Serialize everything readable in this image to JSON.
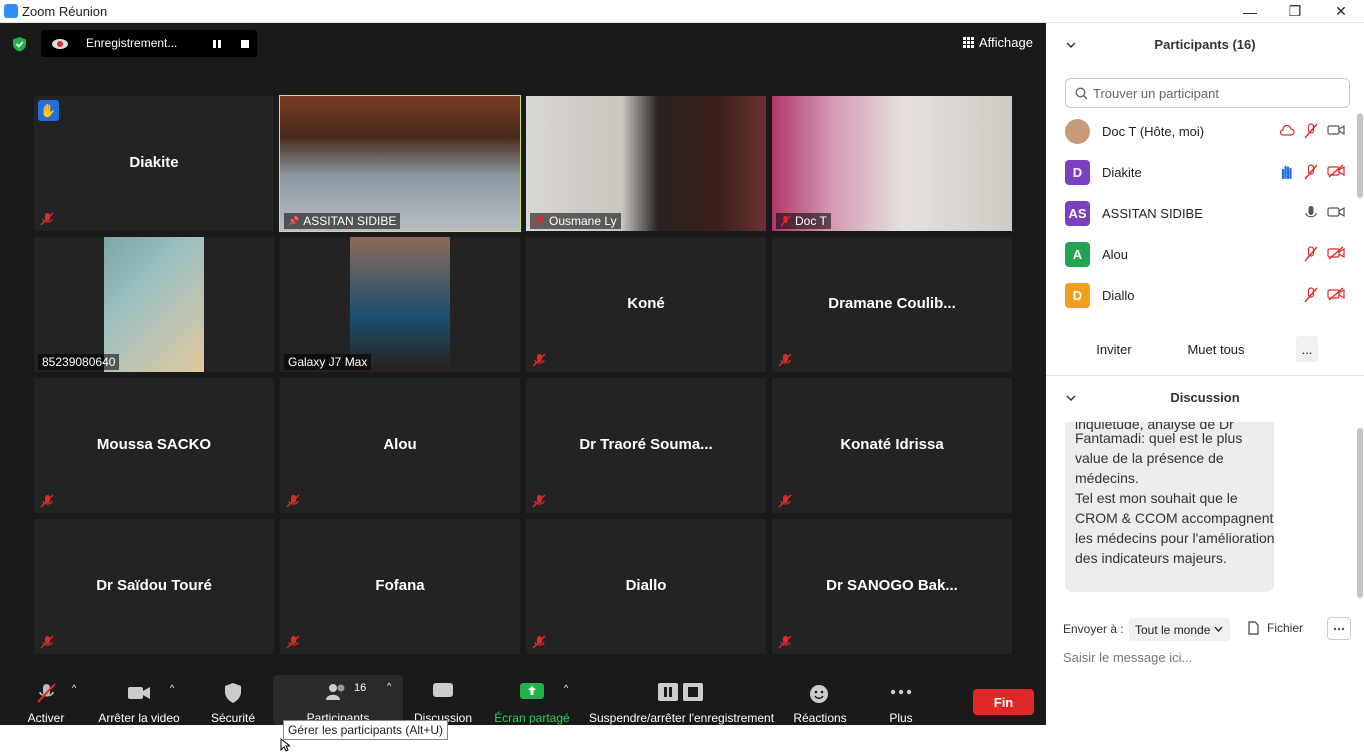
{
  "window": {
    "title": "Zoom Réunion"
  },
  "top": {
    "recording_label": "Enregistrement...",
    "view_label": "Affichage"
  },
  "colors": {
    "active_speaker": "#c9e65a",
    "brand": "#2d8cff",
    "end": "#e02828",
    "green_share": "#24b24b"
  },
  "tiles": [
    {
      "name": "Diakite",
      "hand": true,
      "muted": true,
      "video": false
    },
    {
      "name": "ASSITAN SIDIBE",
      "video": true,
      "muted": false,
      "pinned": true
    },
    {
      "name": "Ousmane Ly",
      "video": true,
      "muted": true
    },
    {
      "name": "Doc T",
      "video": true,
      "muted": true
    },
    {
      "name": "85239080640",
      "video": true,
      "muted": false
    },
    {
      "name": "Galaxy J7 Max",
      "video": true,
      "muted": false
    },
    {
      "name": "Koné",
      "video": false,
      "muted": true
    },
    {
      "name": "Dramane  Coulib...",
      "video": false,
      "muted": true
    },
    {
      "name": "Moussa SACKO",
      "video": false,
      "muted": true
    },
    {
      "name": "Alou",
      "video": false,
      "muted": true
    },
    {
      "name": "Dr  Traoré  Souma...",
      "video": false,
      "muted": true
    },
    {
      "name": "Konaté Idrissa",
      "video": false,
      "muted": true
    },
    {
      "name": "Dr Saïdou Touré",
      "video": false,
      "muted": true
    },
    {
      "name": "Fofana",
      "video": false,
      "muted": true
    },
    {
      "name": "Diallo",
      "video": false,
      "muted": true
    },
    {
      "name": "Dr SANOGO Bak...",
      "video": false,
      "muted": true
    }
  ],
  "toolbar": {
    "unmute": "Activer",
    "video": "Arrêter la video",
    "security": "Sécurité",
    "participants": "Participants",
    "participants_count": "16",
    "chat": "Discussion",
    "share": "Écran partagé",
    "record": "Suspendre/arrêter l'enregistrement",
    "reactions": "Réactions",
    "more": "Plus",
    "end": "Fin",
    "tooltip": "Gérer les participants (Alt+U)"
  },
  "panel": {
    "participants_title": "Participants (16)",
    "search_placeholder": "Trouver un participant",
    "participants": [
      {
        "initials": "",
        "name": "Doc T (Hôte, moi)",
        "color": "#6b6b6b"
      },
      {
        "initials": "D",
        "name": "Diakite",
        "color": "#7b3fbf"
      },
      {
        "initials": "AS",
        "name": "ASSITAN SIDIBE",
        "color": "#7b3fbf"
      },
      {
        "initials": "A",
        "name": "Alou",
        "color": "#23a455"
      },
      {
        "initials": "D",
        "name": "Diallo",
        "color": "#f0a01c"
      }
    ],
    "invite": "Inviter",
    "mute_all": "Muet tous",
    "more": "...",
    "chat_title": "Discussion",
    "chat_message_partial": "Fantamadi: quel est le plus value de la présence de médecins.",
    "chat_message_rest": "Tel est mon souhait que le CROM & CCOM accompagnent les médecins pour l'amélioration des indicateurs majeurs.",
    "chat_top_cut": "inquiétude, analyse de Dr",
    "send_to_label": "Envoyer à :",
    "send_to_value": "Tout le monde",
    "file": "Fichier",
    "input_placeholder": "Saisir le message ici..."
  }
}
